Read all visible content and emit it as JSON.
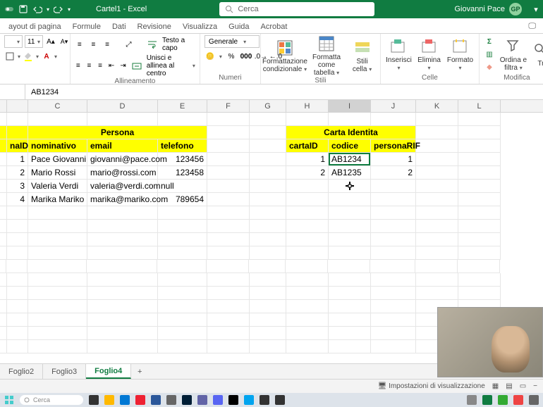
{
  "title": "Cartel1 - Excel",
  "search_placeholder": "Cerca",
  "user": {
    "name": "Giovanni Pace",
    "initials": "GP"
  },
  "tabs": [
    "ayout di pagina",
    "Formule",
    "Dati",
    "Revisione",
    "Visualizza",
    "Guida",
    "Acrobat"
  ],
  "ribbon": {
    "font": {
      "size": "11"
    },
    "wrap": "Testo a capo",
    "merge": "Unisci e allinea al centro",
    "align_label": "Allineamento",
    "numfmt": "Generale",
    "num_label": "Numeri",
    "condfmt": "Formattazione condizionale",
    "astable": "Formatta come tabella",
    "cellstyles": "Stili cella",
    "styles_label": "Stili",
    "insert": "Inserisci",
    "delete": "Elimina",
    "format": "Formato",
    "cells_label": "Celle",
    "sortfilter": "Ordina e filtra",
    "find": "Tr",
    "edit_label": "Modifica"
  },
  "namebox": "",
  "formula": "AB1234",
  "columns": [
    "C",
    "D",
    "E",
    "F",
    "G",
    "H",
    "I",
    "J",
    "K",
    "L"
  ],
  "selected_col": "I",
  "persona": {
    "title": "Persona",
    "headers": {
      "id": "naID",
      "nom": "nominativo",
      "email": "email",
      "tel": "telefono"
    },
    "rows": [
      {
        "id": "1",
        "nom": "Pace Giovanni",
        "email": "giovanni@pace.com",
        "tel": "123456"
      },
      {
        "id": "2",
        "nom": "Mario Rossi",
        "email": "mario@rossi.com",
        "tel": "123458"
      },
      {
        "id": "3",
        "nom": "Valeria Verdi",
        "email": "valeria@verdi.com",
        "tel": "null"
      },
      {
        "id": "4",
        "nom": "Marika Mariko",
        "email": "marika@mariko.com",
        "tel": "789654"
      }
    ]
  },
  "carta": {
    "title": "Carta Identita",
    "headers": {
      "id": "cartaID",
      "codice": "codice",
      "rif": "personaRIF"
    },
    "rows": [
      {
        "id": "1",
        "codice": "AB1234",
        "rif": "1"
      },
      {
        "id": "2",
        "codice": "AB1235",
        "rif": "2"
      }
    ]
  },
  "sheets": {
    "tabs": [
      "Foglio2",
      "Foglio3",
      "Foglio4"
    ],
    "active": 2,
    "add": "+"
  },
  "status": {
    "settings": "Impostazioni di visualizzazione"
  },
  "taskbar_search": "Cerca"
}
